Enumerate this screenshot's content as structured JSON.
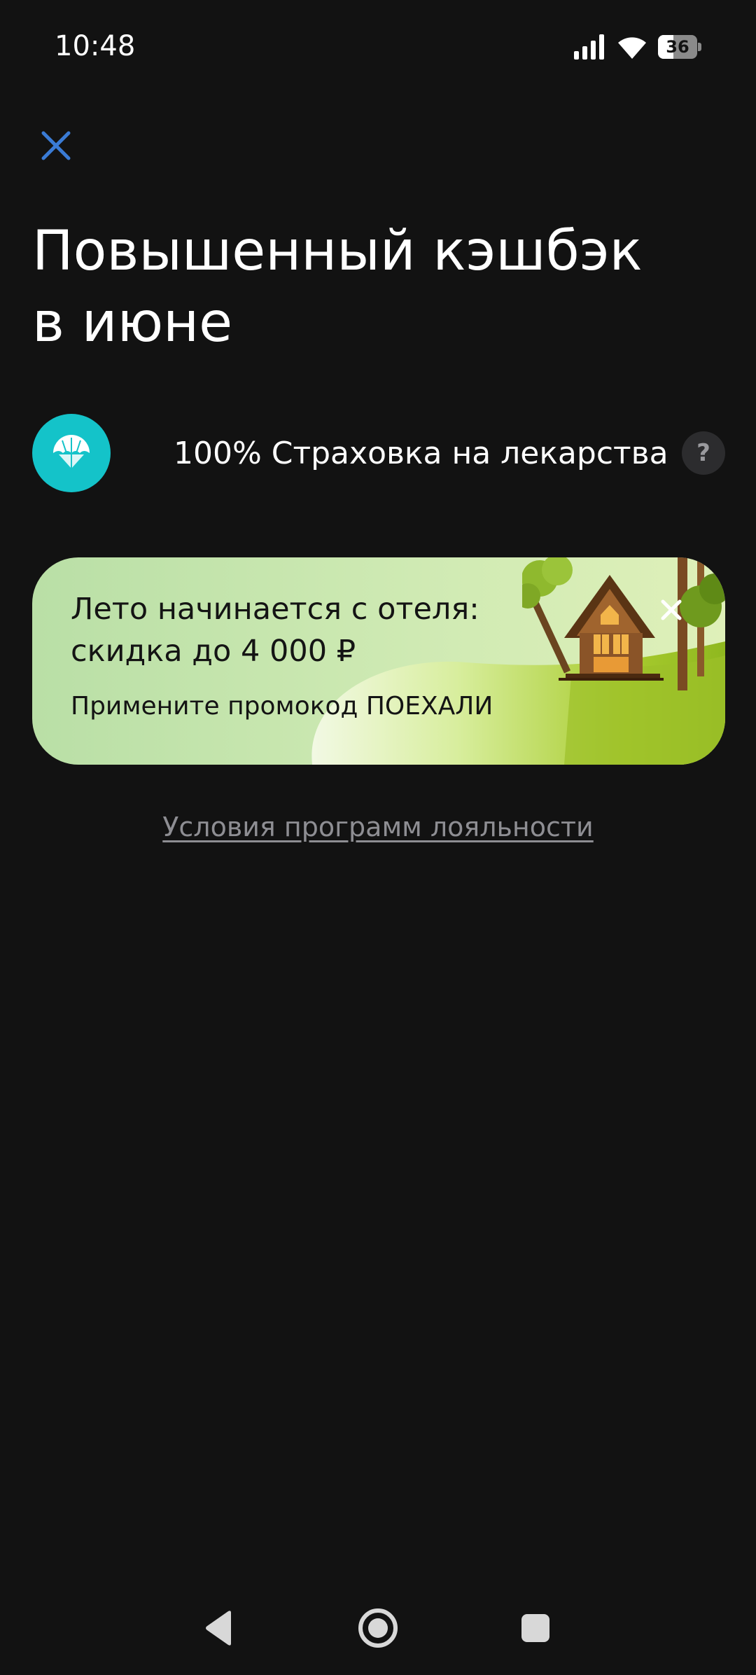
{
  "status_bar": {
    "time": "10:48",
    "battery": "36",
    "icons": [
      "signal-icon",
      "wifi-icon",
      "battery-icon"
    ]
  },
  "header": {
    "close_icon": "close-icon",
    "title_line1": "Повышенный кэшбэк",
    "title_line2": "в июне"
  },
  "cashback": {
    "icon": "umbrella-icon",
    "label": "100% Страховка на лекарства",
    "help_icon": "?"
  },
  "promo": {
    "title_line1": "Лето начинается с отеля:",
    "title_line2": "скидка до 4 000 ₽",
    "subtitle": "Примените промокод ПОЕХАЛИ",
    "close_icon": "close-icon",
    "illustration": "treehouse-illustration"
  },
  "footer": {
    "loyalty_link": "Условия программ лояльности"
  },
  "nav": {
    "back": "back-icon",
    "home": "home-icon",
    "recents": "recents-icon"
  },
  "colors": {
    "background": "#121212",
    "accent_blue": "#3a7bd5",
    "cashback_icon_bg": "#14c3c9",
    "link_gray": "#8e8e93"
  }
}
